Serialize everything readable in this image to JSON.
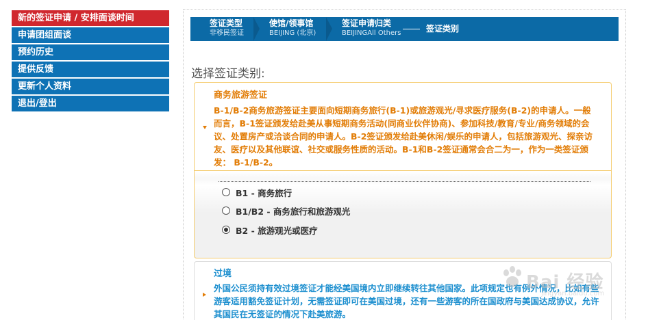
{
  "sidebar": {
    "items": [
      {
        "label": "新的签证申请 / 安排面谈时间",
        "active": true
      },
      {
        "label": "申请团组面谈",
        "active": false
      },
      {
        "label": "预约历史",
        "active": false
      },
      {
        "label": "提供反馈",
        "active": false
      },
      {
        "label": "更新个人资料",
        "active": false
      },
      {
        "label": "退出/登出",
        "active": false
      }
    ]
  },
  "steps": [
    {
      "title": "签证类型",
      "sub": "非移民签证"
    },
    {
      "title": "使馆/领事馆",
      "sub": "BEIJING (北京)"
    },
    {
      "title": "签证申请归类",
      "sub": "BEIJINGAll Others"
    },
    {
      "title": "签证类别",
      "sub": ""
    }
  ],
  "main": {
    "heading": "选择签证类别:",
    "category1": {
      "title": "商务旅游签证",
      "desc": "B-1/B-2商务旅游签证主要面向短期商务旅行(B-1)或旅游观光/寻求医疗服务(B-2)的申请人。一般而言，B-1签证颁发给赴美从事短期商务活动(同商业伙伴协商)、参加科技/教育/专业/商务领域的会议、处置房产或洽谈合同的申请人。B-2签证颁发给赴美休闲/娱乐的申请人，包括旅游观光、探亲访友、医疗以及其他联谊、社交或服务性质的活动。B-1和B-2签证通常会合二为一，作为一类签证颁发： B-1/B-2。",
      "options": [
        {
          "label": "B1 - 商务旅行",
          "checked": false
        },
        {
          "label": "B1/B2 - 商务旅行和旅游观光",
          "checked": false
        },
        {
          "label": "B2 - 旅游观光或医疗",
          "checked": true
        }
      ]
    },
    "category2": {
      "title": "过境",
      "desc": "外国公民须持有效过境签证才能经美国境内立即继续转往其他国家。此项规定也有例外情况，比如有些游客适用豁免签证计划，无需签证即可在美国过境，还有一些游客的所在国政府与美国达成协议，允许其国民在无签证的情况下赴美旅游。"
    }
  },
  "watermark": {
    "text": "Bai 经验",
    "sub": "jingyan.baidu.com"
  },
  "colors": {
    "sidebar": "#0e72b5",
    "sidebar_active": "#d0282e",
    "steps_bar": "#0c6aa6",
    "orange_text": "#e27d07",
    "blue_text": "#1d8fcf"
  }
}
